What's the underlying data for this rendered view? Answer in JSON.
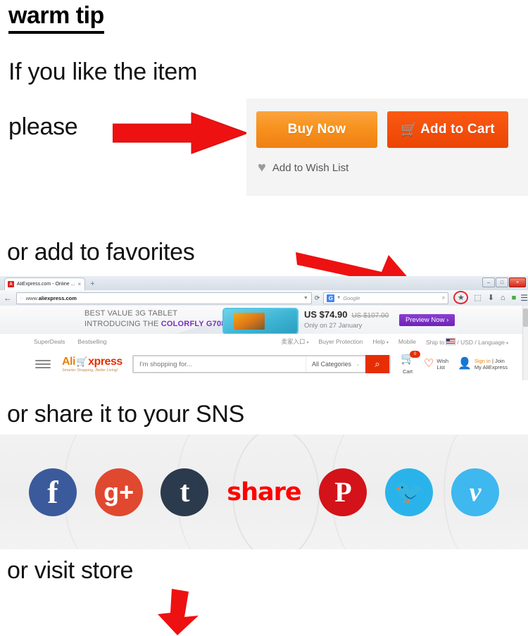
{
  "headings": {
    "warm_tip": "warm tip",
    "if_you_like": "If you like the item",
    "please": "please",
    "or_add_favorites": "or add to favorites",
    "or_share_sns": "or share it to your SNS",
    "or_visit_store": "or visit store"
  },
  "purchase_panel": {
    "buy_now_label": "Buy Now",
    "add_to_cart_label": "Add to Cart",
    "cart_glyph": "🛒",
    "wishlist_label": "Add to Wish List",
    "heart_glyph": "♥",
    "buy_now_color": "#f7921e",
    "add_to_cart_color": "#f4500c",
    "panel_bg": "#f4f4f4"
  },
  "browser": {
    "tab_title": "AliExpress.com - Online ...",
    "tab_favicon_letter": "A",
    "tab_close_glyph": "×",
    "new_tab_glyph": "+",
    "window_controls": [
      "–",
      "□",
      "×"
    ],
    "back_glyph": "←",
    "globe_glyph": "◌",
    "url_prefix": "www.",
    "url_domain": "aliexpress.com",
    "url_dropdown_glyph": "▼",
    "reload_glyph": "⟳",
    "search_engine": "Google",
    "google_letter": "G",
    "search_caret": "▼",
    "search_mag_glyph": "⌕",
    "toolbar_icons": [
      "★",
      "⬚",
      "⬇",
      "⌂",
      "■"
    ],
    "menu_glyph": "☰",
    "highlight_color": "#e8252a"
  },
  "aliexpress": {
    "promo": {
      "line1": "BEST VALUE 3G TABLET",
      "line2_prefix": "INTRODUCING THE ",
      "brand": "COLORFLY G708",
      "price": "US $74.90",
      "old_price": "US $107.00",
      "date": "Only on 27 January",
      "preview_button": "Preview Now ›",
      "brand_color": "#7b2fbe"
    },
    "top_nav_left": [
      "SuperDeals",
      "Bestselling"
    ],
    "top_nav_right": [
      {
        "label": "卖家入口",
        "caret": true
      },
      {
        "label": "Buyer Protection",
        "caret": false
      },
      {
        "label": "Help",
        "caret": true
      },
      {
        "label": "Mobile",
        "caret": false
      }
    ],
    "ship_to_prefix": "Ship to",
    "ship_to_suffix": "/ USD / Language",
    "logo": {
      "ali": "Ali",
      "cart_glyph": "🛒",
      "xpress": "xpress",
      "tagline": "Smarter Shopping, Better Living!"
    },
    "search_placeholder": "I'm shopping for...",
    "all_categories": "All Categories",
    "categories_caret": "⌄",
    "search_button_glyph": "⌕",
    "cart": {
      "glyph": "🛒",
      "badge": "0",
      "label": "Cart"
    },
    "wish_list": {
      "glyph": "♡",
      "line1": "Wish",
      "line2": "List"
    },
    "account": {
      "glyph": "👤",
      "sign_in": "Sign in",
      "separator": " | ",
      "join": "Join",
      "line2": "My AliExpress"
    }
  },
  "social": {
    "share_word": "share",
    "icons": [
      {
        "name": "facebook",
        "glyph": "f",
        "color": "#3b5a9b"
      },
      {
        "name": "googleplus",
        "glyph": "g+",
        "color": "#e0482f"
      },
      {
        "name": "tumblr",
        "glyph": "t",
        "color": "#2c3a4d"
      },
      {
        "name": "pinterest",
        "glyph": "P",
        "color": "#d3121a"
      },
      {
        "name": "twitter",
        "glyph": "🐦",
        "color": "#2ab3ea"
      },
      {
        "name": "vimeo",
        "glyph": "v",
        "color": "#3fb7ef"
      }
    ],
    "share_color": "#ff0000"
  },
  "arrows": {
    "color": "#ee1111"
  }
}
